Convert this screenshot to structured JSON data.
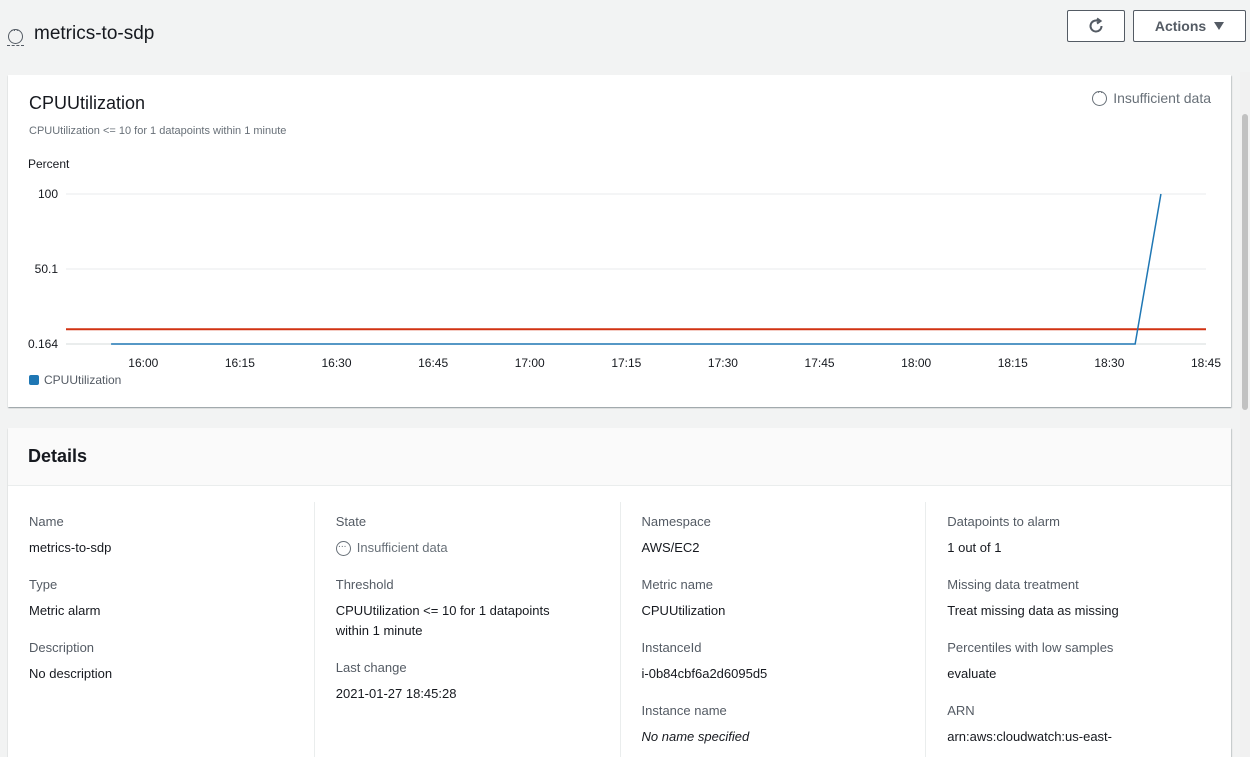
{
  "header": {
    "title": "metrics-to-sdp",
    "actions_label": "Actions"
  },
  "chart": {
    "title": "CPUUtilization",
    "status": "Insufficient data",
    "subtitle": "CPUUtilization <= 10 for 1 datapoints within 1 minute"
  },
  "chart_data": {
    "type": "line",
    "ylabel": "Percent",
    "y_ticks": [
      "100",
      "50.1",
      "0.164"
    ],
    "ylim": [
      0.164,
      100
    ],
    "x_ticks": [
      "16:00",
      "16:15",
      "16:30",
      "16:45",
      "17:00",
      "17:15",
      "17:30",
      "17:45",
      "18:00",
      "18:15",
      "18:30",
      "18:45"
    ],
    "series": [
      {
        "name": "CPUUtilization",
        "color": "#1f77b4",
        "x": [
          "15:55",
          "18:34",
          "18:38"
        ],
        "y": [
          0.164,
          0.164,
          100
        ]
      }
    ],
    "threshold": {
      "value": 10,
      "color": "#d13212"
    },
    "legend": "bottom-left",
    "grid": true
  },
  "details": {
    "heading": "Details",
    "columns": [
      [
        {
          "label": "Name",
          "value": "metrics-to-sdp"
        },
        {
          "label": "Type",
          "value": "Metric alarm"
        },
        {
          "label": "Description",
          "value": "No description"
        }
      ],
      [
        {
          "label": "State",
          "value": "Insufficient data"
        },
        {
          "label": "Threshold",
          "value": "CPUUtilization <= 10 for 1 datapoints within 1 minute"
        },
        {
          "label": "Last change",
          "value": "2021-01-27 18:45:28"
        }
      ],
      [
        {
          "label": "Namespace",
          "value": "AWS/EC2"
        },
        {
          "label": "Metric name",
          "value": "CPUUtilization"
        },
        {
          "label": "InstanceId",
          "value": "i-0b84cbf6a2d6095d5"
        },
        {
          "label": "Instance name",
          "value": "No name specified"
        }
      ],
      [
        {
          "label": "Datapoints to alarm",
          "value": "1 out of 1"
        },
        {
          "label": "Missing data treatment",
          "value": "Treat missing data as missing"
        },
        {
          "label": "Percentiles with low samples",
          "value": "evaluate"
        },
        {
          "label": "ARN",
          "value": "arn:aws:cloudwatch:us-east-"
        }
      ]
    ]
  }
}
